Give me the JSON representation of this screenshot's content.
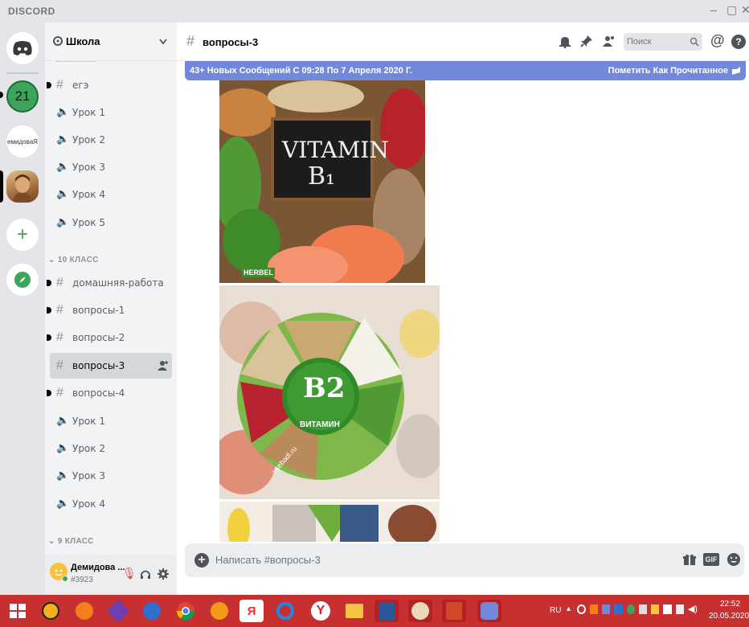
{
  "app": {
    "title": "DISCORD"
  },
  "servers": [
    {
      "name": "21",
      "color": "#3ba55c"
    },
    {
      "name": "емидоваЯ",
      "color": "#ffffff"
    }
  ],
  "guild": {
    "name": "Школа",
    "channels_top": [
      {
        "label": "егэ",
        "type": "text",
        "unread": true
      },
      {
        "label": "Урок 1",
        "type": "voice"
      },
      {
        "label": "Урок 2",
        "type": "voice"
      },
      {
        "label": "Урок 3",
        "type": "voice"
      },
      {
        "label": "Урок 4",
        "type": "voice"
      },
      {
        "label": "Урок 5",
        "type": "voice"
      }
    ],
    "category_10": "10 КЛАСС",
    "channels_10": [
      {
        "label": "домашняя-работа",
        "type": "text",
        "unread": true
      },
      {
        "label": "вопросы-1",
        "type": "text",
        "unread": true
      },
      {
        "label": "вопросы-2",
        "type": "text",
        "unread": true
      },
      {
        "label": "вопросы-3",
        "type": "text",
        "active": true
      },
      {
        "label": "вопросы-4",
        "type": "text",
        "unread": true
      },
      {
        "label": "Урок 1",
        "type": "voice"
      },
      {
        "label": "Урок 2",
        "type": "voice"
      },
      {
        "label": "Урок 3",
        "type": "voice"
      },
      {
        "label": "Урок 4",
        "type": "voice"
      }
    ],
    "category_9": "9 КЛАСС"
  },
  "user": {
    "name": "Демидова ...",
    "tag": "#3923"
  },
  "channel": {
    "name": "вопросы-3"
  },
  "search": {
    "placeholder": "Поиск"
  },
  "banner": {
    "text": "43+ Новых Сообщений С 09:28 По 7 Апреля 2020 Г.",
    "action": "Пометить Как Прочитанное"
  },
  "images": {
    "b1": {
      "line1": "VITAMIN",
      "line2": "B₁",
      "watermark": "HERBEL"
    },
    "b2": {
      "big": "B2",
      "small": "ВИТАМИН",
      "watermark": "vsebadi.ru"
    }
  },
  "composer": {
    "placeholder": "Написать #вопросы-3",
    "gif": "GIF"
  },
  "taskbar": {
    "lang": "RU",
    "time": "22:52",
    "date": "20.05.2020",
    "apps": [
      "Y",
      "Я"
    ]
  },
  "colors": {
    "blurple": "#7289da",
    "green": "#3ba55c",
    "taskbar": "#c63030"
  }
}
